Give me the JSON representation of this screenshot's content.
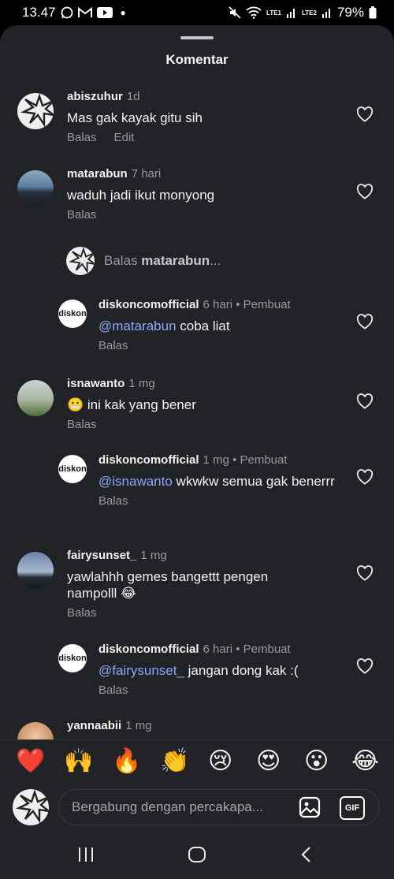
{
  "status_bar": {
    "time": "13.47",
    "battery": "79%",
    "sim1": "LTE1",
    "sim2": "LTE2"
  },
  "sheet": {
    "title": "Komentar"
  },
  "comments": [
    {
      "user": "abiszuhur",
      "time": "1d",
      "text": "Mas gak kayak gitu sih",
      "actions": [
        "Balas",
        "Edit"
      ]
    },
    {
      "user": "matarabun",
      "time": "7 hari",
      "text": "waduh jadi ikut monyong",
      "actions": [
        "Balas"
      ]
    },
    {
      "user": "diskoncomofficial",
      "time": "6 hari",
      "creator": "• Pembuat",
      "mention": "@matarabun",
      "text": " coba liat",
      "actions": [
        "Balas"
      ]
    },
    {
      "user": "isnawanto",
      "time": "1 mg",
      "emoji": "😬",
      "text": " ini kak yang bener",
      "actions": [
        "Balas"
      ]
    },
    {
      "user": "diskoncomofficial",
      "time": "1 mg",
      "creator": "• Pembuat",
      "mention": "@isnawanto",
      "text": " wkwkw semua gak benerrr",
      "actions": [
        "Balas"
      ]
    },
    {
      "user": "fairysunset_",
      "time": "1 mg",
      "text": "yawlahhh gemes bangettt pengen nampolll 😂",
      "actions": [
        "Balas"
      ]
    },
    {
      "user": "diskoncomofficial",
      "time": "6 hari",
      "creator": "• Pembuat",
      "mention": "@fairysunset_",
      "text": " jangan dong kak :(",
      "actions": [
        "Balas"
      ]
    },
    {
      "user": "yannaabii",
      "time": "1 mg"
    }
  ],
  "reply_prompt": {
    "prefix": "Balas ",
    "user": "matarabun",
    "suffix": "..."
  },
  "logo_text": "diskon",
  "emoji_bar": [
    "❤️",
    "🙌",
    "🔥",
    "👏",
    "😢",
    "😍",
    "😮",
    "😂"
  ],
  "composer": {
    "placeholder": "Bergabung dengan percakapa...",
    "gif_label": "GIF"
  },
  "colors": {
    "sheet_bg": "#212327",
    "mention": "#8ea6ff",
    "muted": "#9a9a9a"
  }
}
